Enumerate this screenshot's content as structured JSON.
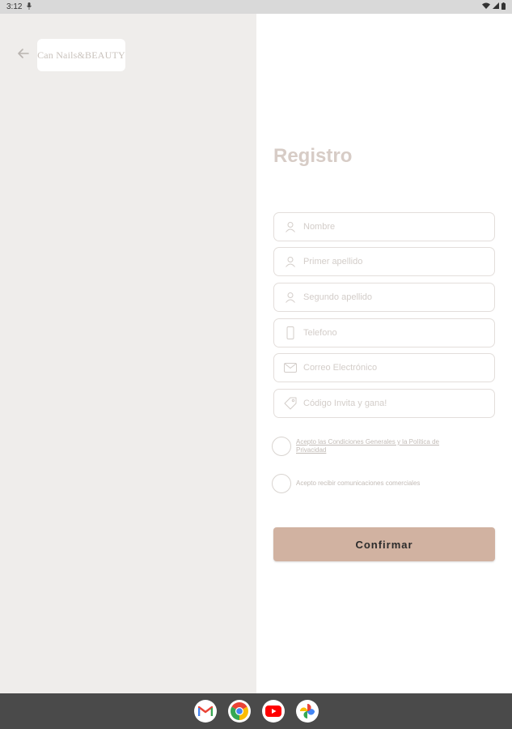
{
  "status_bar": {
    "time": "3:12",
    "icons": [
      "mic-icon",
      "wifi-icon",
      "signal-icon",
      "battery-icon"
    ]
  },
  "header": {
    "back_icon": "back-arrow-icon",
    "logo_text": "Can Nails&BEAUTY"
  },
  "form": {
    "title": "Registro",
    "fields": [
      {
        "placeholder": "Nombre",
        "icon": "user-icon"
      },
      {
        "placeholder": "Primer apellido",
        "icon": "user-icon"
      },
      {
        "placeholder": "Segundo apellido",
        "icon": "user-icon"
      },
      {
        "placeholder": "Telefono",
        "icon": "phone-icon"
      },
      {
        "placeholder": "Correo Electrónico",
        "icon": "mail-icon"
      },
      {
        "placeholder": "Código Invita y gana!",
        "icon": "tag-icon"
      }
    ],
    "checkboxes": [
      {
        "label": "Acepto las Condiciones Generales y la Política de Privacidad",
        "checked": false
      },
      {
        "label": "Acepto recibir comunicaciones comerciales",
        "checked": false
      }
    ],
    "confirm_label": "Confirmar"
  },
  "nav_apps": [
    "gmail-icon",
    "chrome-icon",
    "youtube-icon",
    "photos-icon"
  ],
  "colors": {
    "left_panel": "#efedeb",
    "accent_button": "#d1b2a1",
    "title": "#d7ccc6"
  }
}
